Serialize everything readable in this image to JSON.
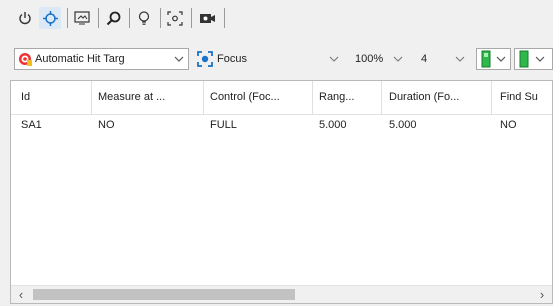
{
  "toolbar_icons": [
    "power-icon",
    "crosshair-icon",
    "image-frame-icon",
    "magnifier-icon",
    "bulb-icon",
    "focus-target-icon",
    "camera-settings-icon"
  ],
  "toolbar2": {
    "hit_target": "Automatic Hit Targ",
    "focus": "Focus",
    "zoom": "100%",
    "count": "4"
  },
  "colors": {
    "accent": "#1a73c9",
    "green": "#2db84a",
    "selected_btn": "#dbe9f7"
  },
  "table": {
    "columns": [
      "Id",
      "Measure at ...",
      "Control (Foc...",
      "Rang...",
      "Duration (Fo...",
      "Find Su"
    ],
    "rows": [
      [
        "SA1",
        "NO",
        "FULL",
        "5.000",
        "5.000",
        "NO"
      ]
    ]
  }
}
